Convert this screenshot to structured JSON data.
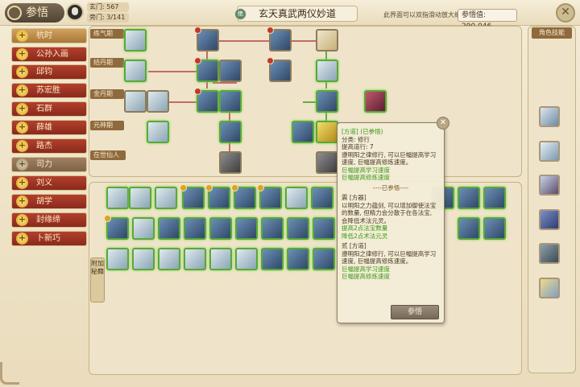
{
  "header": {
    "title": "参悟",
    "stat1": "玄门: 567",
    "stat2": "旁门: 3/141",
    "main_title": "玄天真武两仪妙道",
    "main_title_icon": "绝",
    "hint": "此界面可以双指滑动放大缩小",
    "score": "参悟值: 290,046",
    "close_glyph": "✕"
  },
  "sidebar": {
    "items": [
      {
        "label": "杭时",
        "state": "active"
      },
      {
        "label": "公孙入画",
        "state": "normal"
      },
      {
        "label": "邱钧",
        "state": "normal"
      },
      {
        "label": "苏宏胜",
        "state": "normal"
      },
      {
        "label": "石群",
        "state": "normal"
      },
      {
        "label": "薛雄",
        "state": "normal"
      },
      {
        "label": "路杰",
        "state": "normal"
      },
      {
        "label": "司力",
        "state": "dim"
      },
      {
        "label": "刘义",
        "state": "normal"
      },
      {
        "label": "胡学",
        "state": "normal"
      },
      {
        "label": "封缘缔",
        "state": "normal"
      },
      {
        "label": "卜新巧",
        "state": "normal"
      }
    ],
    "plus_glyph": "+"
  },
  "tiers": [
    "练气期",
    "结丹期",
    "金丹期",
    "元神期",
    "在世仙人"
  ],
  "bottom_tab": "附加秘籍",
  "right_panel": {
    "title": "角色技能"
  },
  "tooltip": {
    "line1": "[方道] (已参悟)",
    "line2": "分类: 修行",
    "line3": "提高道行: 7",
    "line4": "遵明阳之律修行, 可以巨幅提高学习速度, 巨幅提高修炼速度。",
    "line5": "巨幅提高学习速度",
    "line6": "巨幅提高修炼速度",
    "sep": "----已参悟----",
    "line7": "震 [方器]",
    "line8": "以明阳之力蕴剑, 可以增加御使法宝的数量, 但精力会分散于在各法宝, 会降低术法元灵。",
    "line9": "提高2点法宝数量",
    "line10": "降低2点术法元灵",
    "line11": "贰 [方道]",
    "line12": "遵明阳之律修行, 可以巨幅提高学习速度, 巨幅提高修炼速度。",
    "line13": "巨幅提高学习速度",
    "line14": "巨幅提高修炼速度",
    "button": "参悟",
    "close_glyph": "✕"
  }
}
